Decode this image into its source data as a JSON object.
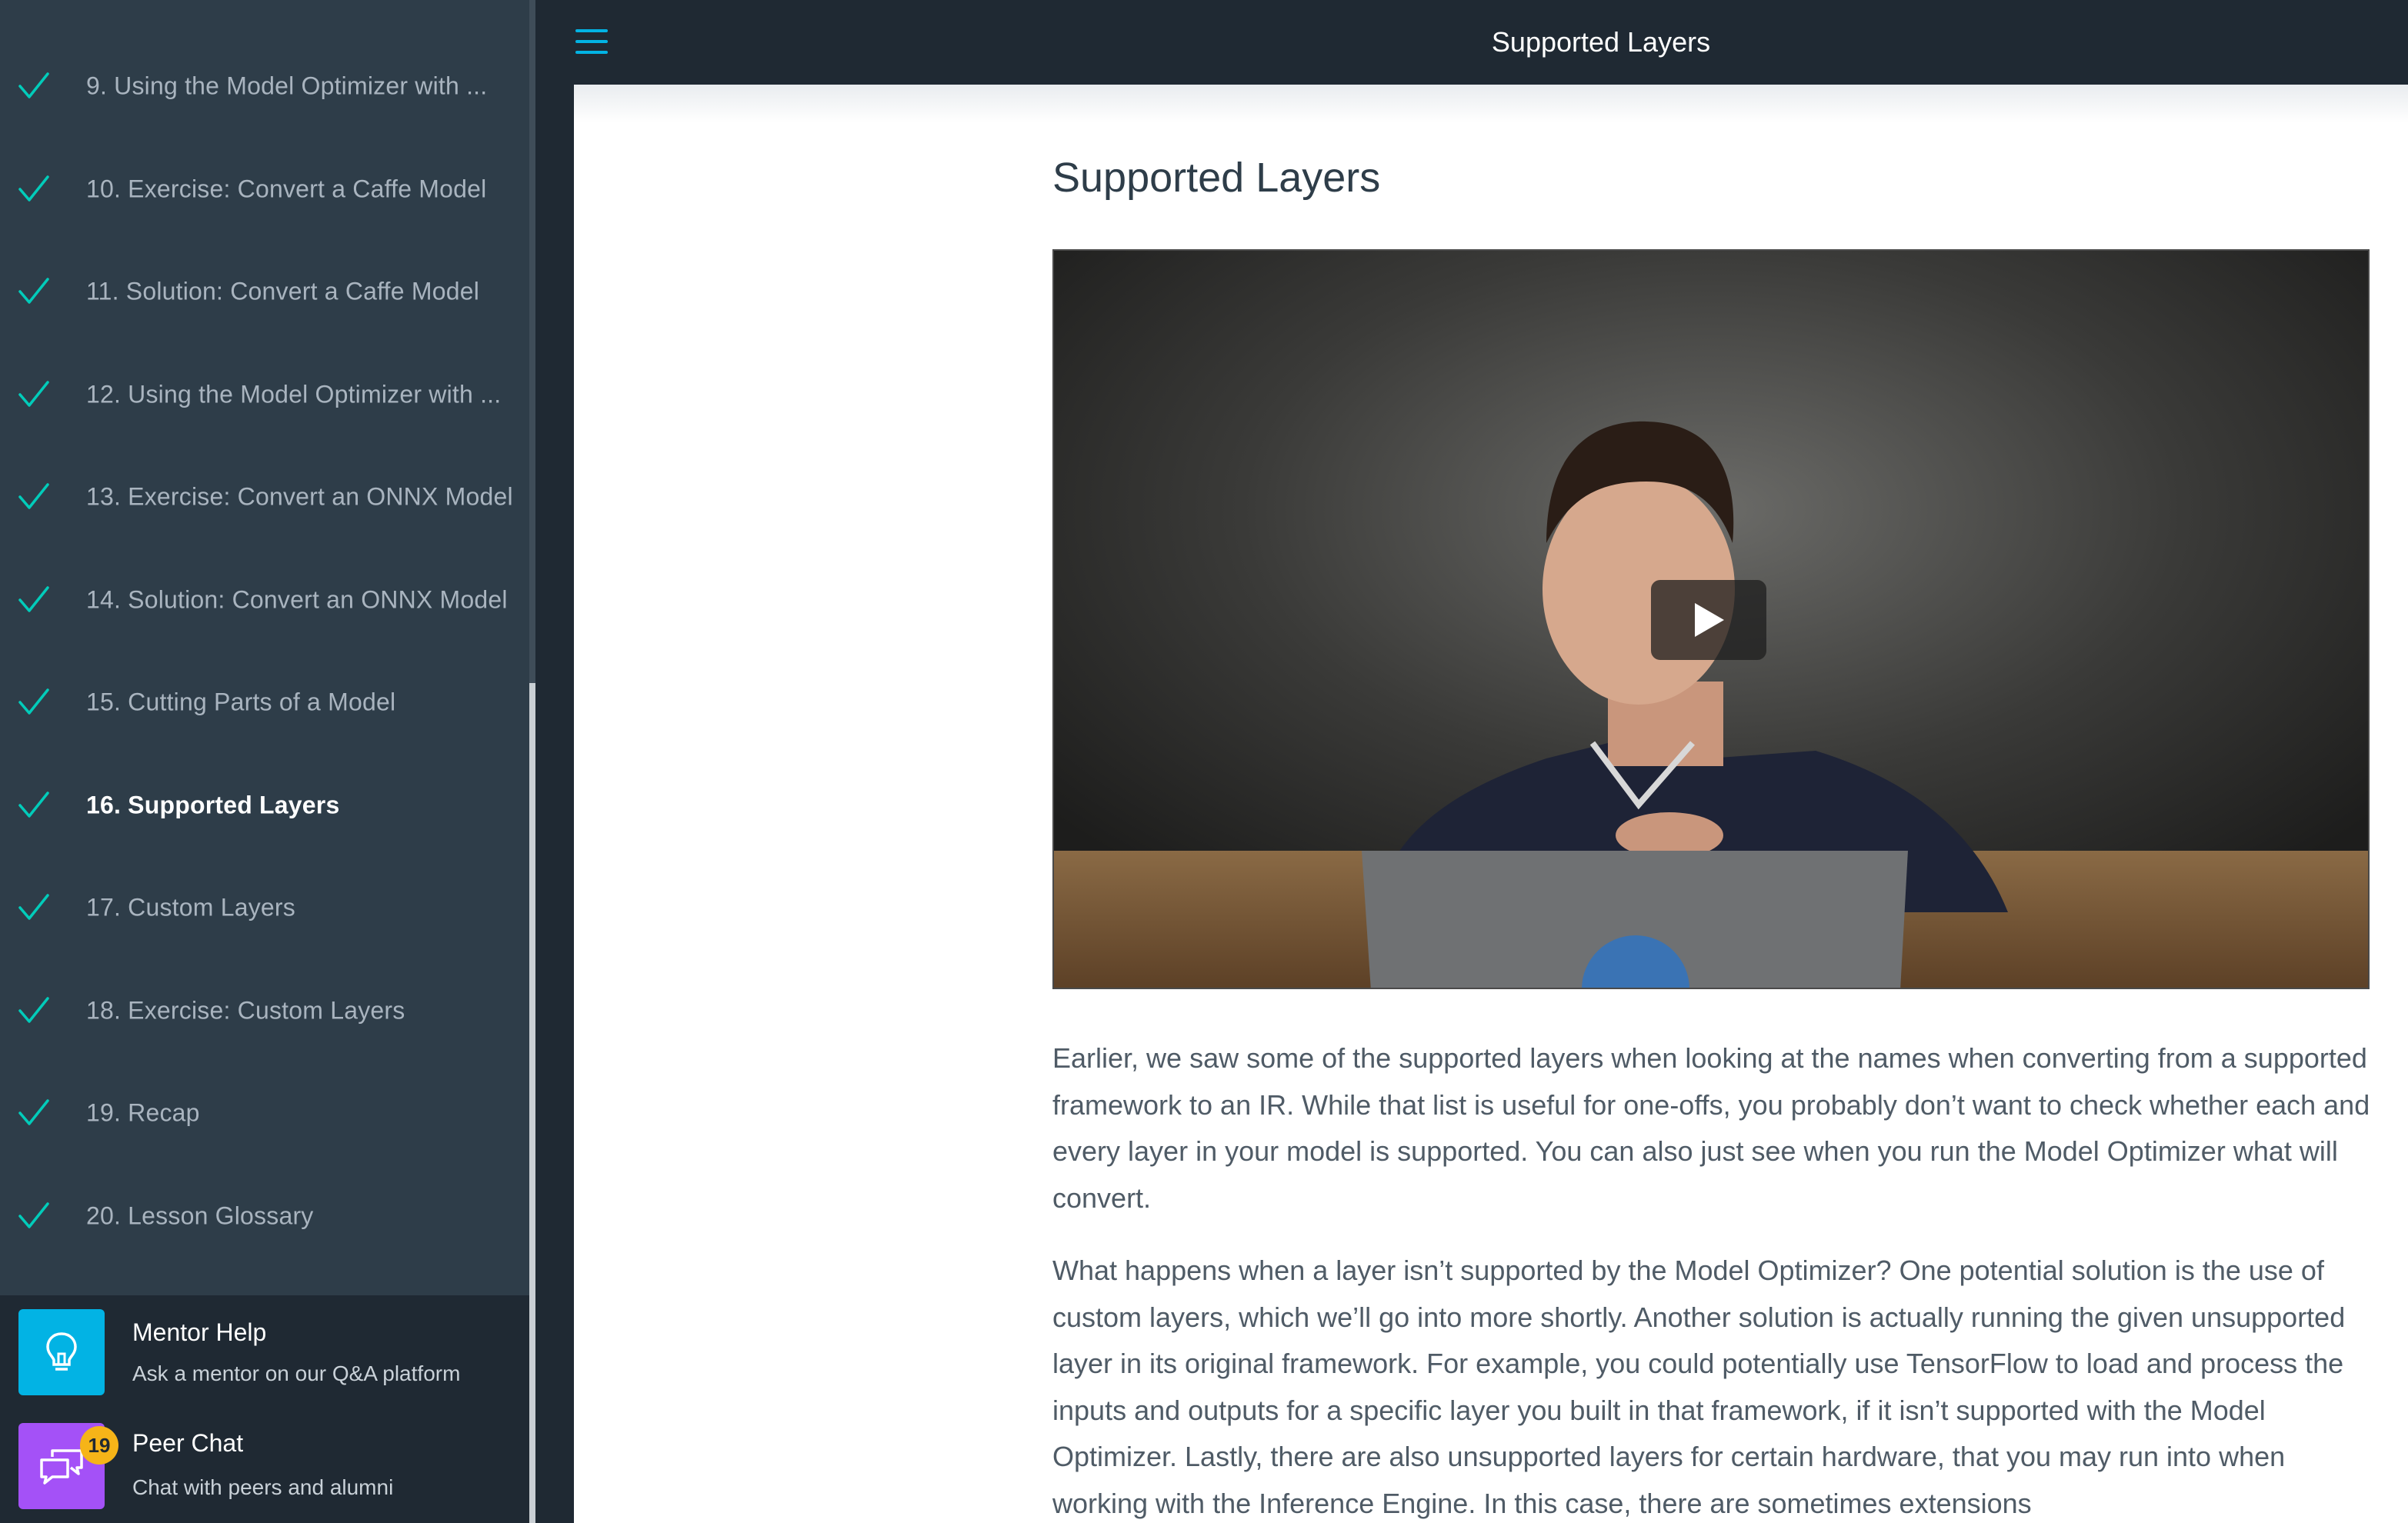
{
  "sidebar": {
    "concepts": [
      {
        "label": "9. Using the Model Optimizer with ...",
        "completed": true,
        "active": false
      },
      {
        "label": "10. Exercise: Convert a Caffe Model",
        "completed": true,
        "active": false
      },
      {
        "label": "11. Solution: Convert a Caffe Model",
        "completed": true,
        "active": false
      },
      {
        "label": "12. Using the Model Optimizer with ...",
        "completed": true,
        "active": false
      },
      {
        "label": "13. Exercise: Convert an ONNX Model",
        "completed": true,
        "active": false
      },
      {
        "label": "14. Solution: Convert an ONNX Model",
        "completed": true,
        "active": false
      },
      {
        "label": "15. Cutting Parts of a Model",
        "completed": true,
        "active": false
      },
      {
        "label": "16. Supported Layers",
        "completed": true,
        "active": true
      },
      {
        "label": "17. Custom Layers",
        "completed": true,
        "active": false
      },
      {
        "label": "18. Exercise: Custom Layers",
        "completed": true,
        "active": false
      },
      {
        "label": "19. Recap",
        "completed": true,
        "active": false
      },
      {
        "label": "20. Lesson Glossary",
        "completed": true,
        "active": false
      }
    ],
    "mentor_help": {
      "title": "Mentor Help",
      "subtitle": "Ask a mentor on our Q&A platform",
      "icon": "lightbulb-icon"
    },
    "peer_chat": {
      "title": "Peer Chat",
      "subtitle": "Chat with peers and alumni",
      "badge": "19",
      "icon": "chat-bubbles-icon"
    }
  },
  "topbar": {
    "title": "Supported Layers",
    "menu_icon": "hamburger-menu-icon"
  },
  "main": {
    "title": "Supported Layers",
    "paragraphs": [
      "Earlier, we saw some of the supported layers when looking at the names when converting from a supported framework to an IR. While that list is useful for one-offs, you probably don’t want to check whether each and every layer in your model is supported. You can also just see when you run the Model Optimizer what will convert.",
      "What happens when a layer isn’t supported by the Model Optimizer? One potential solution is the use of custom layers, which we’ll go into more shortly. Another solution is actually running the given unsupported layer in its original framework. For example, you could potentially use TensorFlow to load and process the inputs and outputs for a specific layer you built in that framework, if it isn’t supported with the Model Optimizer. Lastly, there are also unsupported layers for certain hardware, that you may run into when working with the Inference Engine. In this case, there are sometimes extensions"
    ]
  },
  "colors": {
    "accent": "#02b3e4",
    "check": "#02ccba",
    "peer_chat": "#a451f7",
    "badge": "#f6b418",
    "sidebar_bg": "#2e3d49",
    "topbar_bg": "#1f2933"
  }
}
